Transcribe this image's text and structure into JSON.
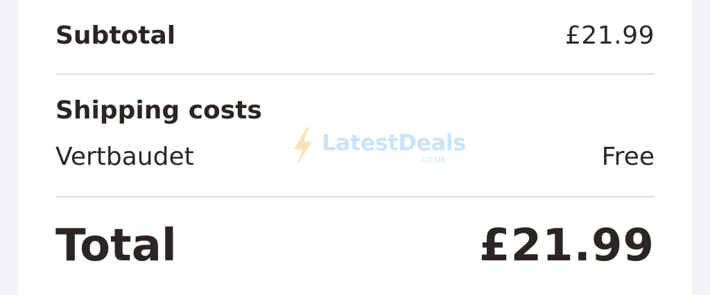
{
  "summary": {
    "subtotal_label": "Subtotal",
    "subtotal_value": "£21.99",
    "shipping_heading": "Shipping costs",
    "carrier_name": "Vertbaudet",
    "carrier_cost": "Free",
    "total_label": "Total",
    "total_value": "£21.99"
  },
  "watermark": {
    "brand": "LatestDeals",
    "domain": ".co.uk",
    "icon": "lightning-bolt-icon"
  },
  "colors": {
    "text": "#2b2624",
    "divider": "#dcdcdc",
    "background": "#f4f4f8",
    "card": "#ffffff",
    "watermark_bolt": "#f5c36b",
    "watermark_text": "#8cc4ef"
  }
}
